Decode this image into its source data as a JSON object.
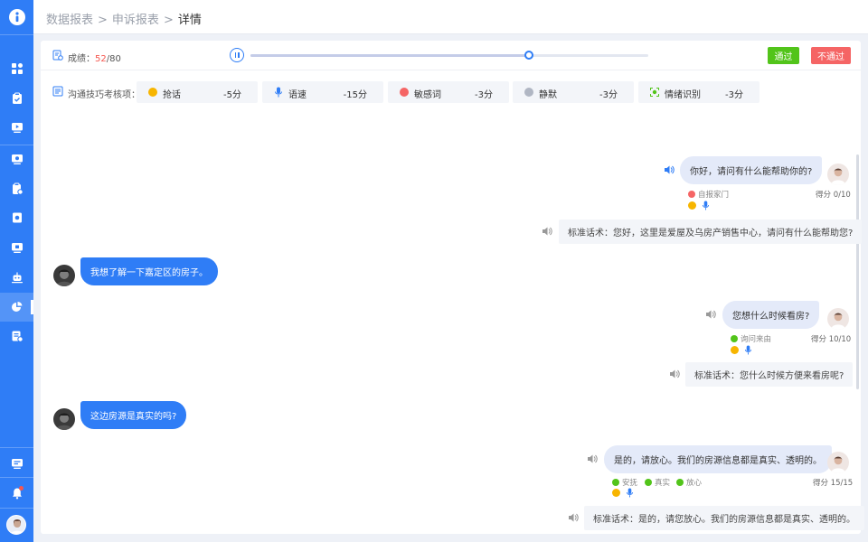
{
  "breadcrumb": [
    "数据报表",
    "申诉报表",
    "详情"
  ],
  "breadcrumb_sep": ">",
  "score": {
    "label": "成绩：",
    "current": "52",
    "sep": "/",
    "total": "80"
  },
  "player": {
    "progress": 0.7
  },
  "actions": {
    "pass": "通过",
    "fail": "不通过"
  },
  "skills": {
    "label": "沟通技巧考核项：",
    "items": [
      {
        "name": "抢话",
        "score": "-5分",
        "icon": "interrupt-icon",
        "color": "#f7b500"
      },
      {
        "name": "语速",
        "score": "-15分",
        "icon": "mic-icon",
        "color": "#2f7df6"
      },
      {
        "name": "敏感词",
        "score": "-3分",
        "icon": "sensitive-word-icon",
        "color": "#f56565"
      },
      {
        "name": "静默",
        "score": "-3分",
        "icon": "silence-icon",
        "color": "#b0b6c3"
      },
      {
        "name": "情绪识别",
        "score": "-3分",
        "icon": "emotion-icon",
        "color": "#52c41a"
      }
    ]
  },
  "conversation": {
    "m1": {
      "text": "你好，请问有什么能帮助你的?",
      "tags": [
        "自报家门"
      ],
      "tag_colors": [
        "#f56565"
      ],
      "score": "得分 0/10"
    },
    "s1": {
      "text": "标准话术：您好，这里是爱屋及乌房产销售中心，请问有什么能帮助您?"
    },
    "m2": {
      "text": "我想了解一下嘉定区的房子。"
    },
    "m3": {
      "text": "您想什么时候看房?",
      "tags": [
        "询问来由"
      ],
      "tag_colors": [
        "#52c41a"
      ],
      "score": "得分 10/10"
    },
    "s2": {
      "text": "标准话术：您什么时候方便来看房呢?"
    },
    "m4": {
      "text": "这边房源是真实的吗?"
    },
    "m5": {
      "text": "是的，请放心。我们的房源信息都是真实、透明的。",
      "tags": [
        "安抚",
        "真实",
        "放心"
      ],
      "tag_colors": [
        "#52c41a",
        "#52c41a",
        "#52c41a"
      ],
      "score": "得分 15/15"
    },
    "s3": {
      "text": "标准话术：是的，请您放心。我们的房源信息都是真实、透明的。"
    }
  }
}
